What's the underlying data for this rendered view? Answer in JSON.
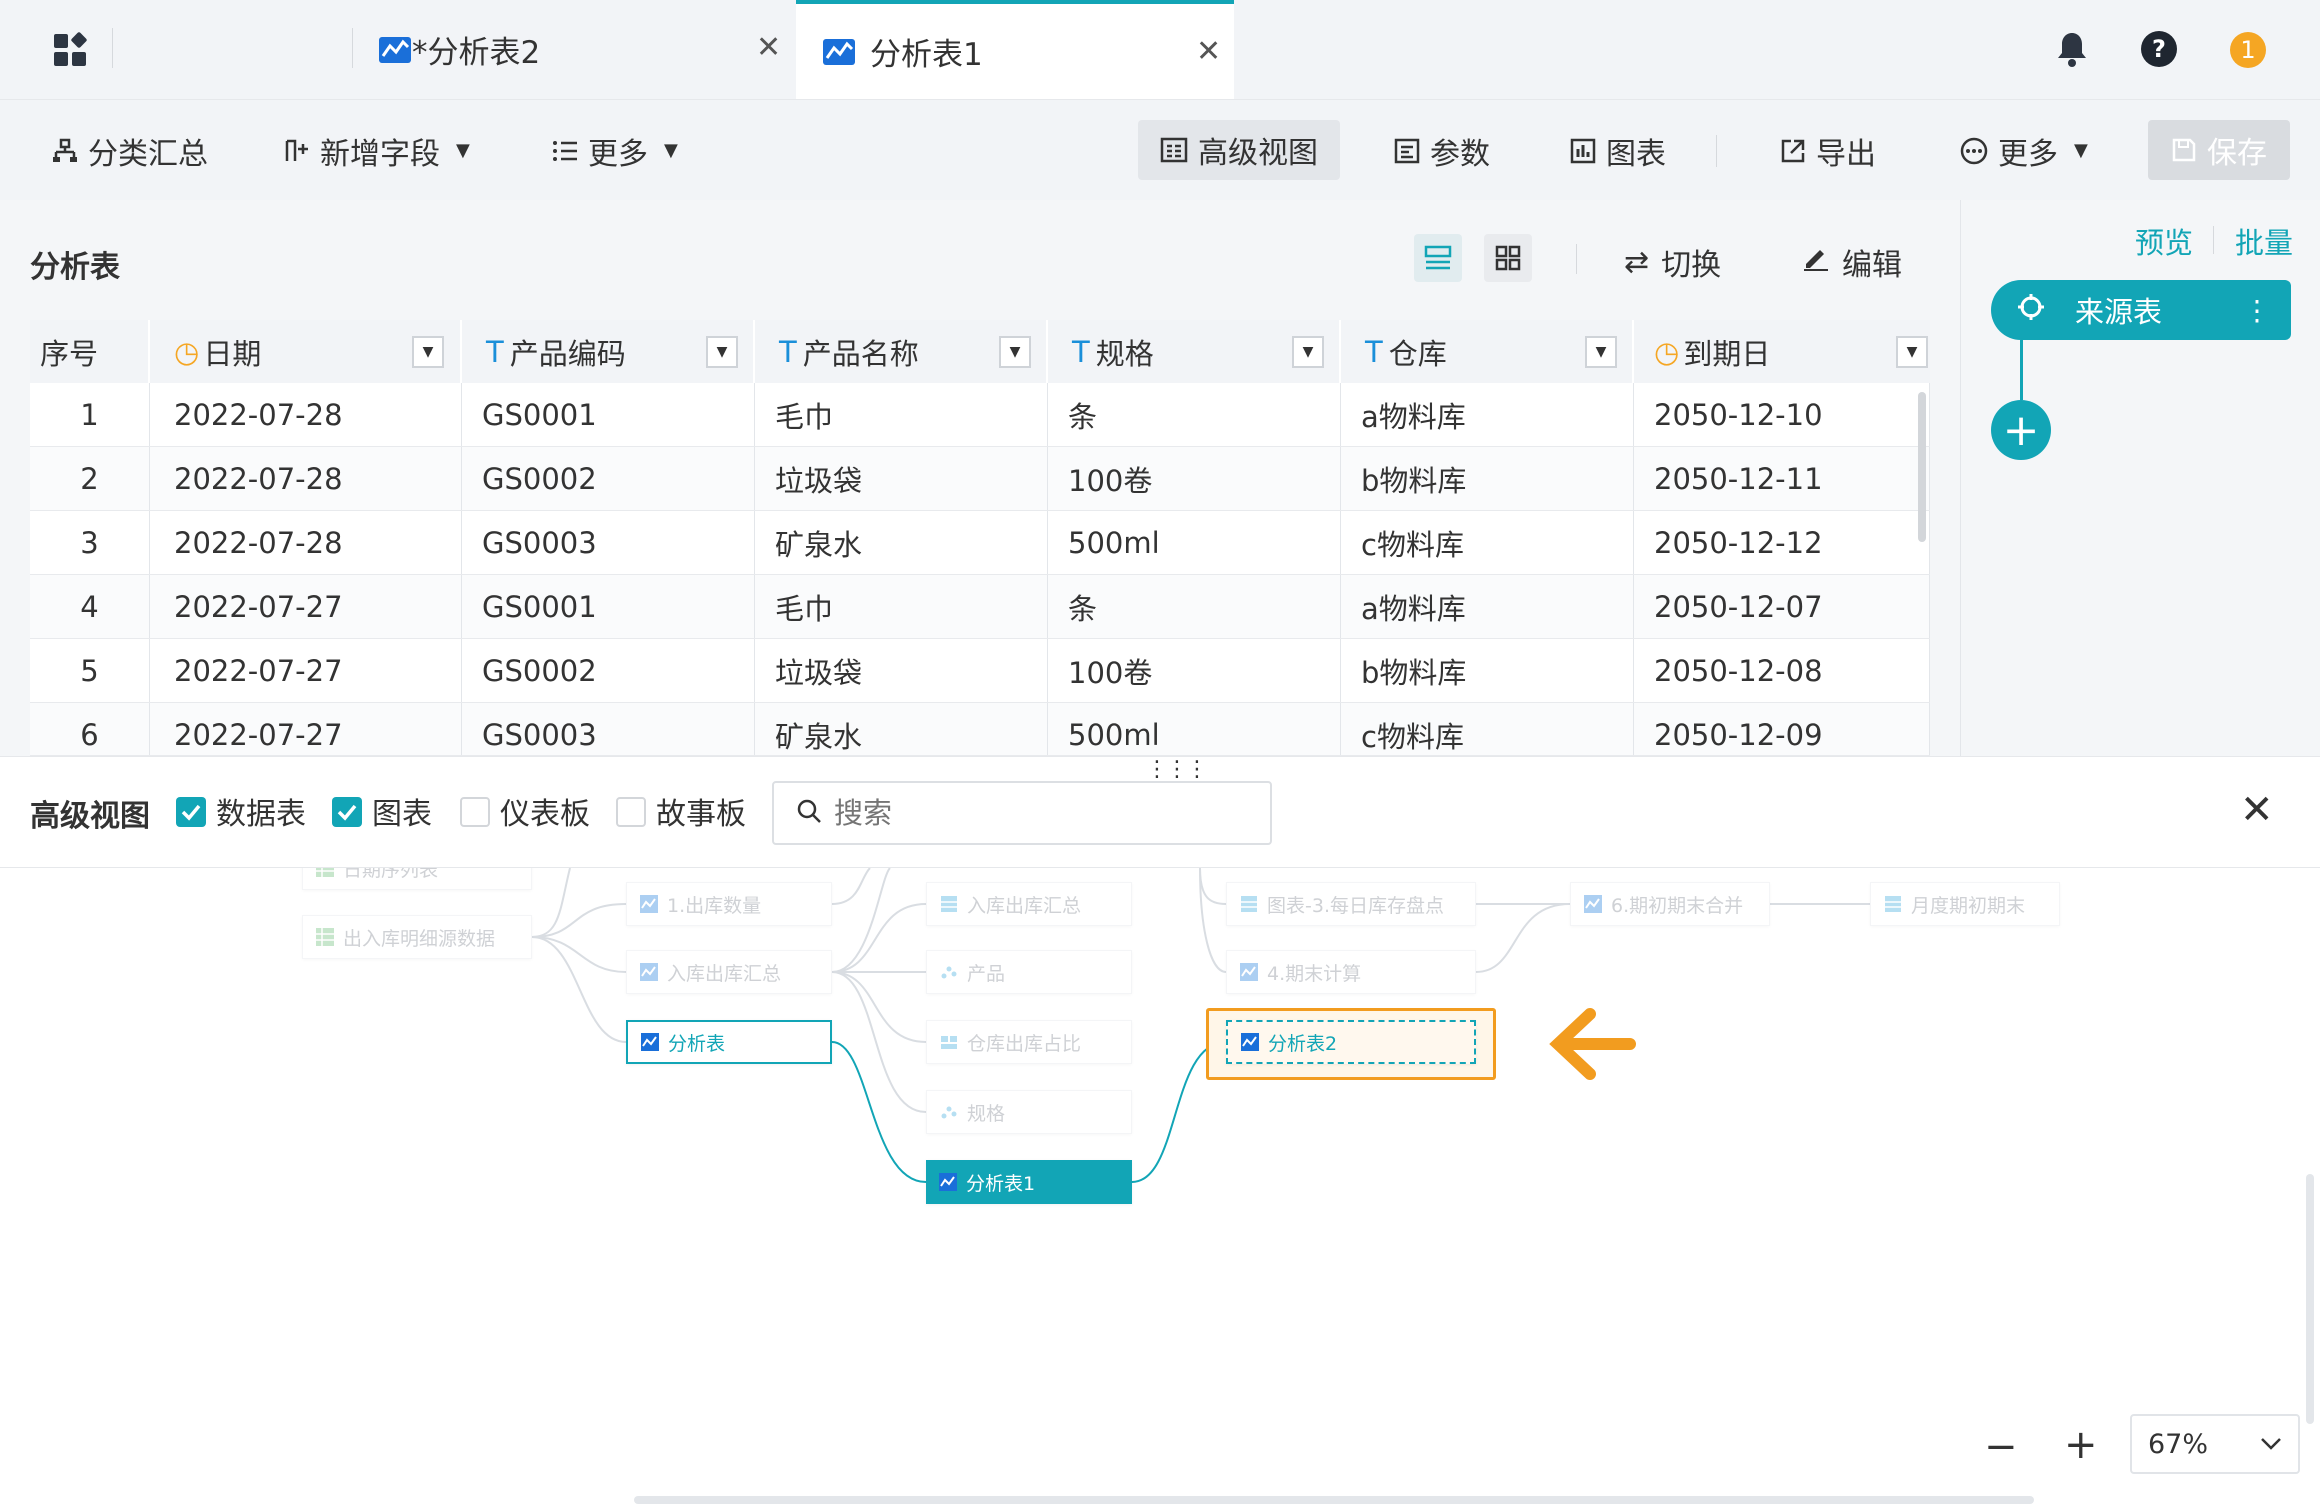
{
  "tabs": [
    {
      "label": "*分析表2",
      "active": false
    },
    {
      "label": "分析表1",
      "active": true
    }
  ],
  "header_badge": "1",
  "toolbar": {
    "left": [
      {
        "label": "分类汇总"
      },
      {
        "label": "新增字段"
      },
      {
        "label": "更多"
      }
    ],
    "right": [
      {
        "label": "高级视图",
        "active": true
      },
      {
        "label": "参数"
      },
      {
        "label": "图表"
      },
      {
        "label": "导出"
      },
      {
        "label": "更多"
      },
      {
        "label": "保存",
        "disabled": true
      }
    ]
  },
  "panel": {
    "title": "分析表",
    "switch_label": "切换",
    "edit_label": "编辑"
  },
  "table": {
    "columns": [
      {
        "label": "序号",
        "type": "none"
      },
      {
        "label": "日期",
        "type": "date"
      },
      {
        "label": "产品编码",
        "type": "text"
      },
      {
        "label": "产品名称",
        "type": "text"
      },
      {
        "label": "规格",
        "type": "text"
      },
      {
        "label": "仓库",
        "type": "text"
      },
      {
        "label": "到期日",
        "type": "date"
      }
    ],
    "type_glyphs": {
      "text": "T",
      "date": "◷"
    },
    "rows": [
      [
        "1",
        "2022-07-28",
        "GS0001",
        "毛巾",
        "条",
        "a物料库",
        "2050-12-10"
      ],
      [
        "2",
        "2022-07-28",
        "GS0002",
        "垃圾袋",
        "100卷",
        "b物料库",
        "2050-12-11"
      ],
      [
        "3",
        "2022-07-28",
        "GS0003",
        "矿泉水",
        "500ml",
        "c物料库",
        "2050-12-12"
      ],
      [
        "4",
        "2022-07-27",
        "GS0001",
        "毛巾",
        "条",
        "a物料库",
        "2050-12-07"
      ],
      [
        "5",
        "2022-07-27",
        "GS0002",
        "垃圾袋",
        "100卷",
        "b物料库",
        "2050-12-08"
      ],
      [
        "6",
        "2022-07-27",
        "GS0003",
        "矿泉水",
        "500ml",
        "c物料库",
        "2050-12-09"
      ]
    ]
  },
  "side": {
    "preview": "预览",
    "batch": "批量",
    "source_node": "来源表"
  },
  "advanced": {
    "title": "高级视图",
    "filters": [
      {
        "label": "数据表",
        "checked": true
      },
      {
        "label": "图表",
        "checked": true
      },
      {
        "label": "仪表板",
        "checked": false
      },
      {
        "label": "故事板",
        "checked": false
      }
    ],
    "search_placeholder": "搜索"
  },
  "lineage": {
    "nodes": [
      {
        "id": "n0",
        "label": "日期序列表",
        "kind": "table"
      },
      {
        "id": "n1",
        "label": "出入库明细源数据",
        "kind": "table"
      },
      {
        "id": "n2",
        "label": "1.出库数量",
        "kind": "analysis"
      },
      {
        "id": "n3",
        "label": "入库出库汇总",
        "kind": "analysis"
      },
      {
        "id": "n4",
        "label": "分析表",
        "kind": "analysis",
        "state": "selected"
      },
      {
        "id": "n5",
        "label": "入库出库汇总",
        "kind": "chart-table"
      },
      {
        "id": "n6",
        "label": "产品",
        "kind": "chart-scatter"
      },
      {
        "id": "n7",
        "label": "仓库出库占比",
        "kind": "chart-pie"
      },
      {
        "id": "n8",
        "label": "规格",
        "kind": "chart-scatter"
      },
      {
        "id": "n9",
        "label": "分析表1",
        "kind": "analysis",
        "state": "current"
      },
      {
        "id": "n10",
        "label": "图表-3.每日库存盘点",
        "kind": "chart-table"
      },
      {
        "id": "n11",
        "label": "4.期末计算",
        "kind": "analysis"
      },
      {
        "id": "n12",
        "label": "分析表2",
        "kind": "analysis",
        "state": "highlighted"
      },
      {
        "id": "n13",
        "label": "6.期初期末合并",
        "kind": "analysis"
      },
      {
        "id": "n14",
        "label": "月度期初期末",
        "kind": "chart-table"
      }
    ]
  },
  "zoom": {
    "value": "67%"
  },
  "colors": {
    "accent": "#12a5b6",
    "highlight": "#f29c1f",
    "badge": "#f5a623"
  }
}
